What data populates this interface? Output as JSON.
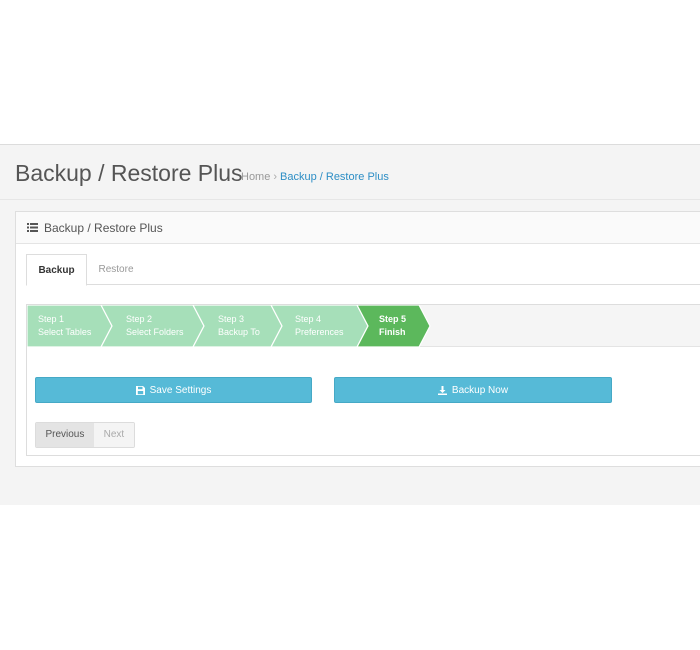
{
  "header": {
    "title": "Backup / Restore Plus",
    "breadcrumb": {
      "home": "Home",
      "separator": "›",
      "current": "Backup / Restore Plus"
    }
  },
  "panel": {
    "icon": "list-icon",
    "title": "Backup / Restore Plus"
  },
  "tabs": [
    {
      "label": "Backup",
      "active": true
    },
    {
      "label": "Restore",
      "active": false
    }
  ],
  "wizard": {
    "current_step": 5,
    "steps": [
      {
        "step": "Step 1",
        "label": "Select Tables"
      },
      {
        "step": "Step 2",
        "label": "Select Folders"
      },
      {
        "step": "Step 3",
        "label": "Backup To"
      },
      {
        "step": "Step 4",
        "label": "Preferences"
      },
      {
        "step": "Step 5",
        "label": "Finish"
      }
    ],
    "buttons": {
      "save": {
        "label": "Save Settings",
        "icon": "floppy-disk-icon"
      },
      "backup": {
        "label": "Backup Now",
        "icon": "download-icon"
      }
    },
    "pager": {
      "previous": "Previous",
      "next": "Next"
    }
  },
  "colors": {
    "step_done": "#a6dfb9",
    "step_current": "#5cb85c",
    "button_info": "#56bad7",
    "link": "#2d8ec5"
  }
}
